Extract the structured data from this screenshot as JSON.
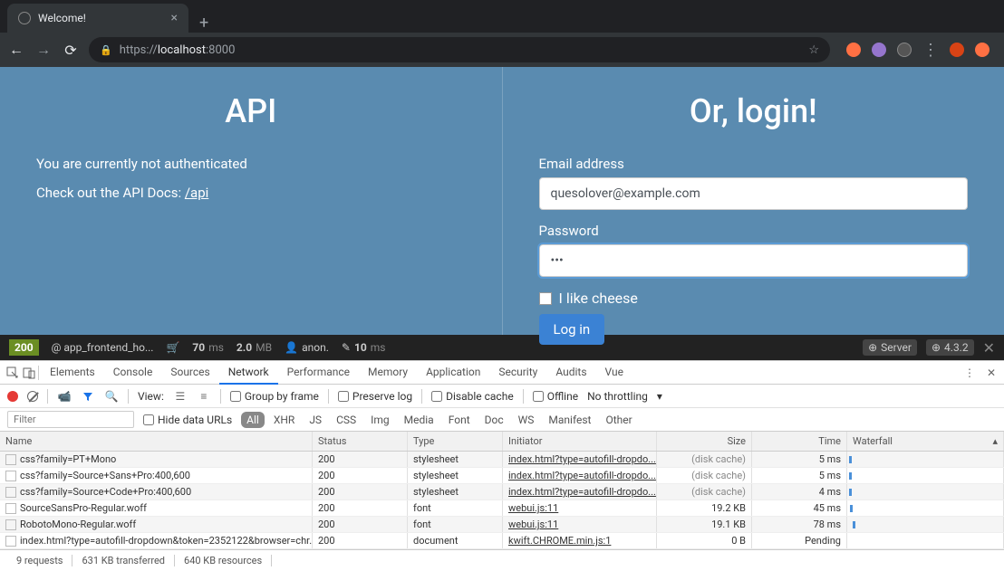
{
  "browser": {
    "tab_title": "Welcome!",
    "url_prefix": "https://",
    "url_host": "localhost",
    "url_port": ":8000"
  },
  "page": {
    "api_heading": "API",
    "auth_status": "You are currently not authenticated",
    "docs_prefix": "Check out the API Docs: ",
    "docs_link": "/api",
    "login_heading": "Or, login!",
    "email_label": "Email address",
    "email_value": "quesolover@example.com",
    "password_label": "Password",
    "password_value": "•••",
    "cheese_label": "I like cheese",
    "login_button": "Log in"
  },
  "debug": {
    "status": "200",
    "route": "@ app_frontend_ho...",
    "time_val": "70",
    "time_unit": "ms",
    "mem_val": "2.0",
    "mem_unit": "MB",
    "user": "anon.",
    "render_val": "10",
    "render_unit": "ms",
    "server": "Server",
    "version": "4.3.2"
  },
  "devtools": {
    "tabs": [
      "Elements",
      "Console",
      "Sources",
      "Network",
      "Performance",
      "Memory",
      "Application",
      "Security",
      "Audits",
      "Vue"
    ],
    "active_tab": 3,
    "view_label": "View:",
    "group_frame": "Group by frame",
    "preserve_log": "Preserve log",
    "disable_cache": "Disable cache",
    "offline": "Offline",
    "throttling": "No throttling",
    "filter_placeholder": "Filter",
    "hide_data_urls": "Hide data URLs",
    "filter_pills": [
      "All",
      "XHR",
      "JS",
      "CSS",
      "Img",
      "Media",
      "Font",
      "Doc",
      "WS",
      "Manifest",
      "Other"
    ],
    "columns": [
      "Name",
      "Status",
      "Type",
      "Initiator",
      "Size",
      "Time",
      "Waterfall"
    ],
    "rows": [
      {
        "name": "css?family=PT+Mono",
        "status": "200",
        "type": "stylesheet",
        "initiator": "index.html?type=autofill-dropdo...",
        "size": "(disk cache)",
        "time": "5 ms",
        "wf": 2,
        "cache": true
      },
      {
        "name": "css?family=Source+Sans+Pro:400,600",
        "status": "200",
        "type": "stylesheet",
        "initiator": "index.html?type=autofill-dropdo...",
        "size": "(disk cache)",
        "time": "5 ms",
        "wf": 2,
        "cache": true
      },
      {
        "name": "css?family=Source+Code+Pro:400,600",
        "status": "200",
        "type": "stylesheet",
        "initiator": "index.html?type=autofill-dropdo...",
        "size": "(disk cache)",
        "time": "4 ms",
        "wf": 2,
        "cache": true
      },
      {
        "name": "SourceSansPro-Regular.woff",
        "status": "200",
        "type": "font",
        "initiator": "webui.js:11",
        "size": "19.2 KB",
        "time": "45 ms",
        "wf": 3,
        "cache": false
      },
      {
        "name": "RobotoMono-Regular.woff",
        "status": "200",
        "type": "font",
        "initiator": "webui.js:11",
        "size": "19.1 KB",
        "time": "78 ms",
        "wf": 6,
        "cache": false
      },
      {
        "name": "index.html?type=autofill-dropdown&token=2352122&browser=chr...",
        "status": "200",
        "type": "document",
        "initiator": "kwift.CHROME.min.js:1",
        "size": "0 B",
        "time": "Pending",
        "wf": 0,
        "cache": false
      }
    ],
    "status_requests": "9 requests",
    "status_transferred": "631 KB transferred",
    "status_resources": "640 KB resources"
  }
}
